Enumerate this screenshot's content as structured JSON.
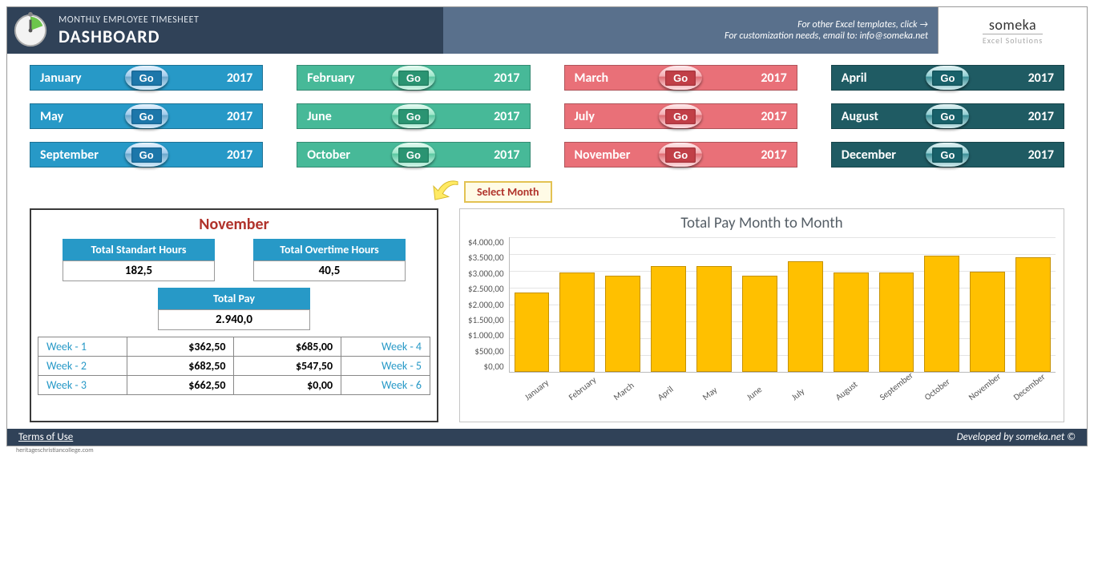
{
  "header": {
    "subtitle": "MONTHLY EMPLOYEE TIMESHEET",
    "title": "DASHBOARD",
    "link_text": "For other Excel templates, click →",
    "email_text": "For customization needs, email to: info@someka.net"
  },
  "brand": {
    "name": "someka",
    "tag": "Excel Solutions"
  },
  "months": {
    "year": "2017",
    "go": "Go",
    "list": [
      {
        "name": "January",
        "cls": "blue"
      },
      {
        "name": "February",
        "cls": "green"
      },
      {
        "name": "March",
        "cls": "red"
      },
      {
        "name": "April",
        "cls": "teal"
      },
      {
        "name": "May",
        "cls": "blue"
      },
      {
        "name": "June",
        "cls": "green"
      },
      {
        "name": "July",
        "cls": "red"
      },
      {
        "name": "August",
        "cls": "teal"
      },
      {
        "name": "September",
        "cls": "blue"
      },
      {
        "name": "October",
        "cls": "green"
      },
      {
        "name": "November",
        "cls": "red"
      },
      {
        "name": "December",
        "cls": "teal"
      }
    ]
  },
  "select_label": "Select Month",
  "panel": {
    "selected": "November",
    "std_h": "Total Standart Hours",
    "std_v": "182,5",
    "ot_h": "Total Overtime Hours",
    "ot_v": "40,5",
    "pay_h": "Total Pay",
    "pay_v": "2.940,0",
    "weeks": [
      {
        "l": "Week - 1",
        "lv": "$362,50",
        "rv": "$685,00",
        "r": "Week - 4"
      },
      {
        "l": "Week - 2",
        "lv": "$682,50",
        "rv": "$547,50",
        "r": "Week - 5"
      },
      {
        "l": "Week - 3",
        "lv": "$662,50",
        "rv": "$0,00",
        "r": "Week - 6"
      }
    ]
  },
  "chart_data": {
    "type": "bar",
    "title": "Total Pay Month to Month",
    "ylabel": "",
    "xlabel": "",
    "ylim": [
      0,
      4000
    ],
    "yticks": [
      "$4.000,00",
      "$3.500,00",
      "$3.000,00",
      "$2.500,00",
      "$2.000,00",
      "$1.500,00",
      "$1.000,00",
      "$500,00",
      "$0,00"
    ],
    "categories": [
      "January",
      "February",
      "March",
      "April",
      "May",
      "June",
      "July",
      "August",
      "September",
      "October",
      "November",
      "December"
    ],
    "values": [
      2300,
      2900,
      2800,
      3100,
      3100,
      2800,
      3250,
      2900,
      2900,
      3400,
      2940,
      3350
    ]
  },
  "footer": {
    "terms": "Terms of Use",
    "dev": "Developed by someka.net ©",
    "note": "heritageschristiancollege.com"
  }
}
